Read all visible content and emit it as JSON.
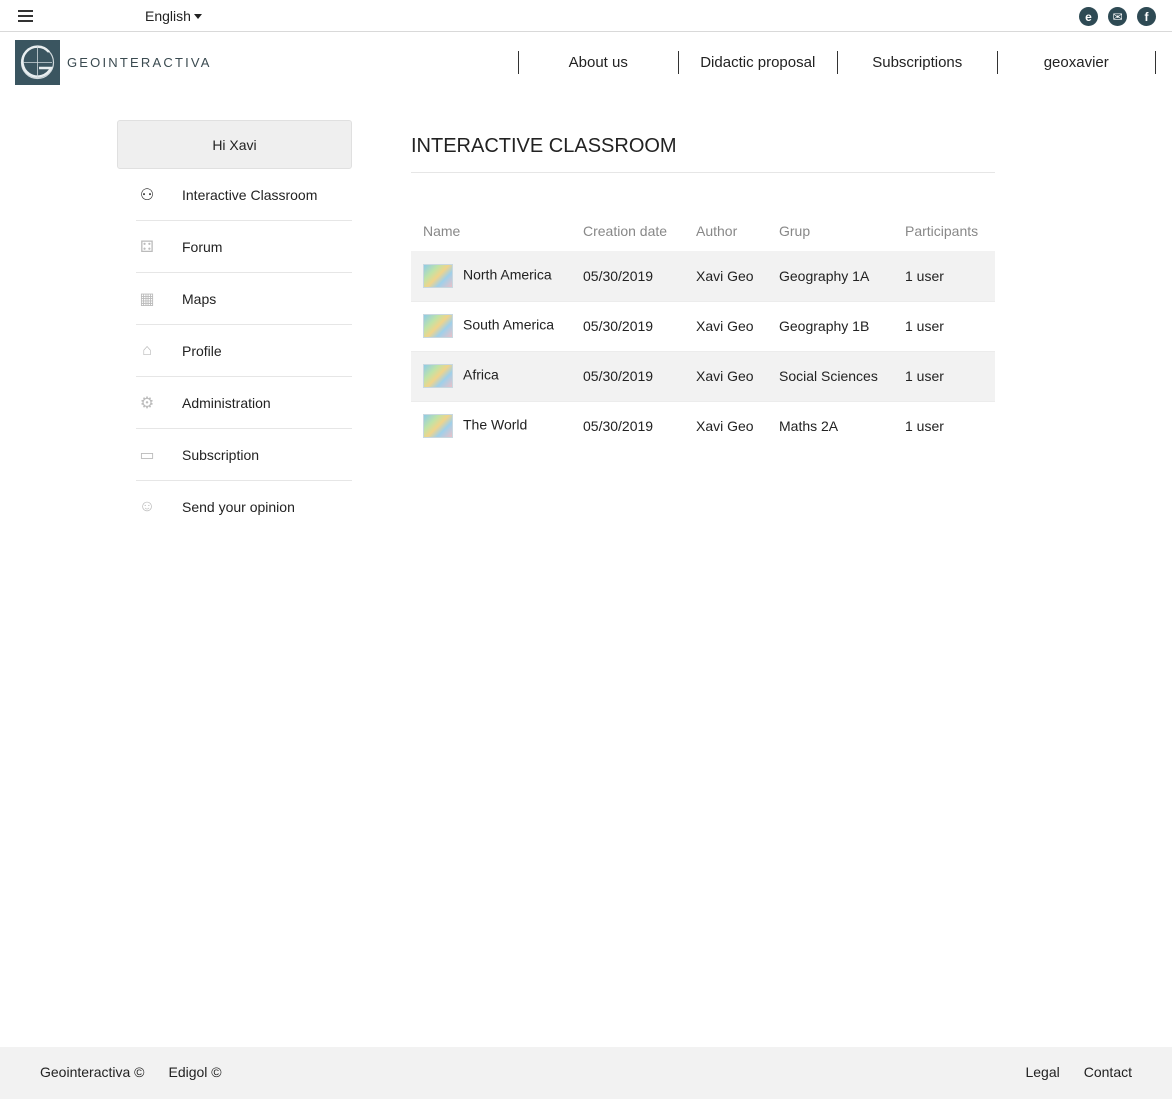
{
  "topbar": {
    "language": "English",
    "social": [
      {
        "icon": "e-icon",
        "glyph": "e"
      },
      {
        "icon": "mail-icon",
        "glyph": "✉"
      },
      {
        "icon": "facebook-icon",
        "glyph": "f"
      }
    ]
  },
  "header": {
    "logo_text": "GEOINTERACTIVA",
    "nav": [
      "About us",
      "Didactic proposal",
      "Subscriptions",
      "geoxavier"
    ]
  },
  "sidebar": {
    "greeting": "Hi Xavi",
    "items": [
      {
        "label": "Interactive Classroom",
        "icon": "classroom-icon",
        "glyph": "⚇"
      },
      {
        "label": "Forum",
        "icon": "forum-icon",
        "glyph": "⚃"
      },
      {
        "label": "Maps",
        "icon": "maps-icon",
        "glyph": "▦"
      },
      {
        "label": "Profile",
        "icon": "home-icon",
        "glyph": "⌂"
      },
      {
        "label": "Administration",
        "icon": "gear-icon",
        "glyph": "⚙"
      },
      {
        "label": "Subscription",
        "icon": "card-icon",
        "glyph": "▭"
      },
      {
        "label": "Send your opinion",
        "icon": "smile-icon",
        "glyph": "☺"
      }
    ]
  },
  "main": {
    "title": "INTERACTIVE CLASSROOM",
    "columns": [
      "Name",
      "Creation date",
      "Author",
      "Grup",
      "Participants"
    ],
    "rows": [
      {
        "name": "North America",
        "date": "05/30/2019",
        "author": "Xavi Geo",
        "group": "Geography 1A",
        "participants": "1 user"
      },
      {
        "name": "South America",
        "date": "05/30/2019",
        "author": "Xavi Geo",
        "group": "Geography 1B",
        "participants": "1 user"
      },
      {
        "name": "Africa",
        "date": "05/30/2019",
        "author": "Xavi Geo",
        "group": "Social Sciences",
        "participants": "1 user"
      },
      {
        "name": "The World",
        "date": "05/30/2019",
        "author": "Xavi Geo",
        "group": "Maths 2A",
        "participants": "1 user"
      }
    ]
  },
  "footer": {
    "left": [
      "Geointeractiva ©",
      "Edigol ©"
    ],
    "right": [
      "Legal",
      "Contact"
    ]
  }
}
